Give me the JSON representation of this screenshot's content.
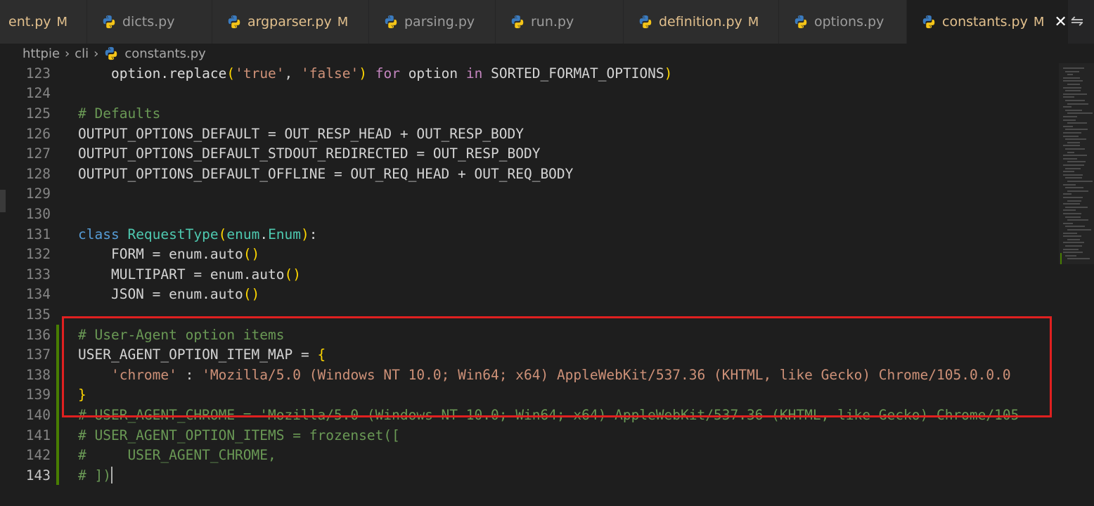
{
  "tabs": [
    {
      "label": "ent.py",
      "badge": "M",
      "modified": true,
      "active": false
    },
    {
      "label": "dicts.py",
      "badge": "",
      "modified": false,
      "active": false
    },
    {
      "label": "argparser.py",
      "badge": "M",
      "modified": true,
      "active": false
    },
    {
      "label": "parsing.py",
      "badge": "",
      "modified": false,
      "active": false
    },
    {
      "label": "run.py",
      "badge": "",
      "modified": false,
      "active": false
    },
    {
      "label": "definition.py",
      "badge": "M",
      "modified": true,
      "active": false
    },
    {
      "label": "options.py",
      "badge": "",
      "modified": false,
      "active": false
    },
    {
      "label": "constants.py",
      "badge": "M",
      "modified": true,
      "active": true
    }
  ],
  "tab_close_glyph": "✕",
  "split_icon": "⇋",
  "breadcrumb": {
    "items": [
      "httpie",
      "cli",
      "constants.py"
    ],
    "separator": "›"
  },
  "editor": {
    "current_line": 143,
    "lines": [
      {
        "n": "123",
        "tokens": [
          [
            "    ",
            ""
          ],
          [
            "option.replace",
            "t-def"
          ],
          [
            "(",
            "t-br1"
          ],
          [
            "'true'",
            "t-str"
          ],
          [
            ", ",
            ""
          ],
          [
            "'false'",
            "t-str"
          ],
          [
            ")",
            "t-br1"
          ],
          [
            " ",
            ""
          ],
          [
            "for",
            "t-kw"
          ],
          [
            " option ",
            ""
          ],
          [
            "in",
            "t-kw"
          ],
          [
            " SORTED_FORMAT_OPTIONS",
            ""
          ],
          [
            ")",
            "t-br1"
          ]
        ]
      },
      {
        "n": "124",
        "tokens": []
      },
      {
        "n": "125",
        "tokens": [
          [
            "# Defaults",
            "t-com"
          ]
        ]
      },
      {
        "n": "126",
        "tokens": [
          [
            "OUTPUT_OPTIONS_DEFAULT = OUT_RESP_HEAD + OUT_RESP_BODY",
            ""
          ]
        ]
      },
      {
        "n": "127",
        "tokens": [
          [
            "OUTPUT_OPTIONS_DEFAULT_STDOUT_REDIRECTED = OUT_RESP_BODY",
            ""
          ]
        ]
      },
      {
        "n": "128",
        "tokens": [
          [
            "OUTPUT_OPTIONS_DEFAULT_OFFLINE = OUT_REQ_HEAD + OUT_REQ_BODY",
            ""
          ]
        ]
      },
      {
        "n": "129",
        "tokens": []
      },
      {
        "n": "130",
        "tokens": []
      },
      {
        "n": "131",
        "tokens": [
          [
            "class",
            "t-kw2"
          ],
          [
            " ",
            ""
          ],
          [
            "RequestType",
            "t-cls"
          ],
          [
            "(",
            "t-br1"
          ],
          [
            "enum",
            "t-cls"
          ],
          [
            ".",
            ""
          ],
          [
            "Enum",
            "t-cls"
          ],
          [
            ")",
            "t-br1"
          ],
          [
            ":",
            ""
          ]
        ]
      },
      {
        "n": "132",
        "tokens": [
          [
            "    FORM = enum.auto",
            ""
          ],
          [
            "()",
            "t-br1"
          ]
        ]
      },
      {
        "n": "133",
        "tokens": [
          [
            "    MULTIPART = enum.auto",
            ""
          ],
          [
            "()",
            "t-br1"
          ]
        ]
      },
      {
        "n": "134",
        "tokens": [
          [
            "    JSON = enum.auto",
            ""
          ],
          [
            "()",
            "t-br1"
          ]
        ]
      },
      {
        "n": "135",
        "tokens": []
      },
      {
        "n": "136",
        "tokens": [
          [
            "# User-Agent option items",
            "t-com"
          ]
        ]
      },
      {
        "n": "137",
        "tokens": [
          [
            "USER_AGENT_OPTION_ITEM_MAP = ",
            ""
          ],
          [
            "{",
            "t-br1"
          ]
        ]
      },
      {
        "n": "138",
        "tokens": [
          [
            "    ",
            ""
          ],
          [
            "'chrome'",
            "t-str"
          ],
          [
            " : ",
            ""
          ],
          [
            "'Mozilla/5.0 (Windows NT 10.0; Win64; x64) AppleWebKit/537.36 (KHTML, like Gecko) Chrome/105.0.0.0",
            "t-str"
          ]
        ]
      },
      {
        "n": "139",
        "tokens": [
          [
            "}",
            "t-br1"
          ]
        ]
      },
      {
        "n": "140",
        "tokens": [
          [
            "# USER_AGENT_CHROME = 'Mozilla/5.0 (Windows NT 10.0; Win64; x64) AppleWebKit/537.36 (KHTML, like Gecko) Chrome/105",
            "t-com"
          ]
        ]
      },
      {
        "n": "141",
        "tokens": [
          [
            "# USER_AGENT_OPTION_ITEMS = frozenset([",
            "t-com"
          ]
        ]
      },
      {
        "n": "142",
        "tokens": [
          [
            "#     USER_AGENT_CHROME,",
            "t-com"
          ]
        ]
      },
      {
        "n": "143",
        "tokens": [
          [
            "# ])",
            "t-com"
          ]
        ]
      }
    ]
  },
  "colors": {
    "highlight_box": "#e02020",
    "git_added": "#487e02",
    "modified_badge": "#e2c08d"
  }
}
